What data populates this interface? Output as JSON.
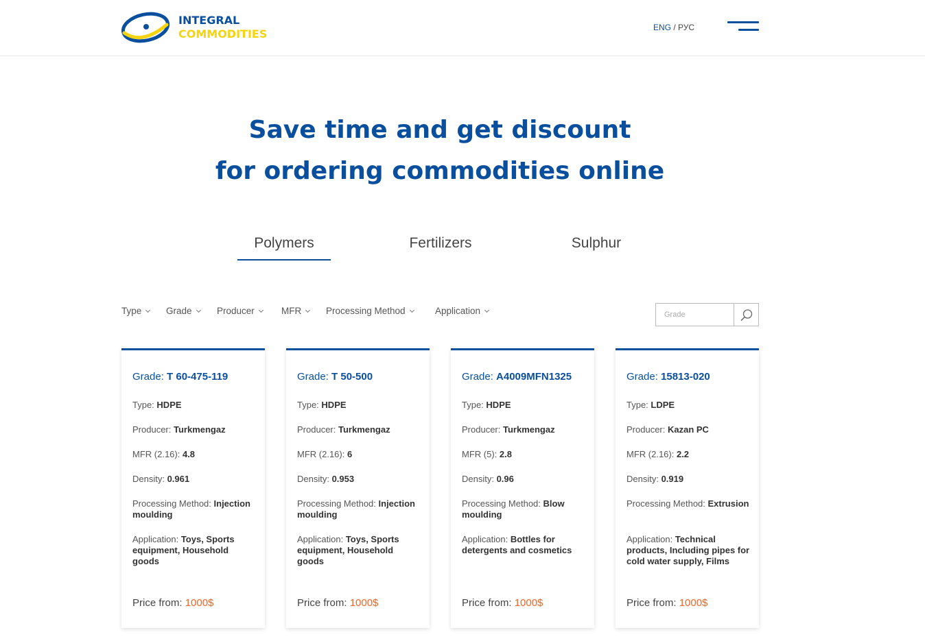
{
  "brand": {
    "line1": "INTEGRAL",
    "line2": "COMMODITIES",
    "primary_color": "#0a4f9e",
    "secondary_color": "#f5d40f"
  },
  "header": {
    "lang_active": "ENG",
    "lang_sep": " / ",
    "lang_other": "РУС",
    "menu_icon": "hamburger-icon"
  },
  "hero": {
    "line1": "Save time and get discount",
    "line2": "for ordering commodities online"
  },
  "tabs": [
    {
      "label": "Polymers",
      "active": true
    },
    {
      "label": "Fertilizers",
      "active": false
    },
    {
      "label": "Sulphur",
      "active": false
    }
  ],
  "filters": [
    "Type",
    "Grade",
    "Producer",
    "MFR",
    "Processing Method",
    "Application"
  ],
  "search": {
    "placeholder": "Grade",
    "icon": "search-icon"
  },
  "card_labels": {
    "grade": "Grade: ",
    "type": "Type: ",
    "producer": "Producer: ",
    "density": "Density: ",
    "processing": "Processing Method: ",
    "application": "Application: ",
    "price": "Price from: "
  },
  "price_color": "#f26522",
  "cards": [
    {
      "grade": "T 60-475-119",
      "type": "HDPE",
      "producer": "Turkmengaz",
      "mfr_label": "MFR (2.16): ",
      "mfr": "4.8",
      "density": "0.961",
      "processing": "Injection moulding",
      "application": "Toys, Sports equipment, Household goods",
      "price": "1000$"
    },
    {
      "grade": "T 50-500",
      "type": "HDPE",
      "producer": "Turkmengaz",
      "mfr_label": "MFR (2.16): ",
      "mfr": "6",
      "density": "0.953",
      "processing": "Injection moulding",
      "application": "Toys, Sports equipment, Household goods",
      "price": "1000$"
    },
    {
      "grade": "A4009MFN1325",
      "type": "HDPE",
      "producer": "Turkmengaz",
      "mfr_label": "MFR (5): ",
      "mfr": "2.8",
      "density": "0.96",
      "processing": "Blow moulding",
      "application": "Bottles for detergents and cosmetics",
      "price": "1000$"
    },
    {
      "grade": "15813-020",
      "type": "LDPE",
      "producer": "Kazan PC",
      "mfr_label": "MFR (2.16): ",
      "mfr": "2.2",
      "density": "0.919",
      "processing": "Extrusion",
      "application": "Technical products, Including pipes for cold water supply, Films",
      "price": "1000$"
    }
  ]
}
